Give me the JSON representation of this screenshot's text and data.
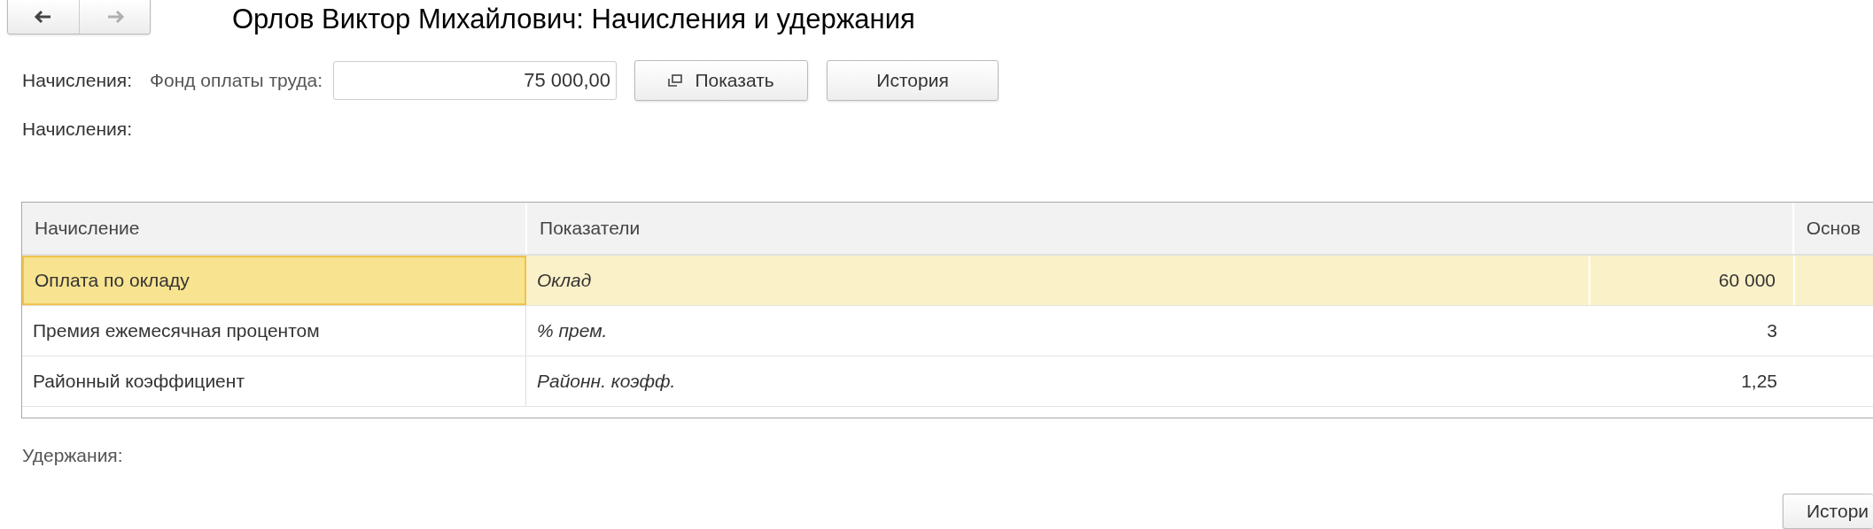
{
  "nav_buttons": [
    {
      "kind": "back",
      "disabled": false
    },
    {
      "kind": "forward",
      "disabled": true
    }
  ],
  "title": "Орлов Виктор Михайлович: Начисления и удержания",
  "accruals_label": "Начисления:",
  "fund_label": "Фонд оплаты труда:",
  "fund_value": "75 000,00",
  "show_button": "Показать",
  "history_button": "История",
  "section_label": "Начисления:",
  "table": {
    "columns": [
      "Начисление",
      "Показатели",
      "Основ"
    ],
    "rows": [
      {
        "accrual": "Оплата по окладу",
        "indicator": "Оклад",
        "value": "60 000",
        "selected": true
      },
      {
        "accrual": "Премия ежемесячная процентом",
        "indicator": "% прем.",
        "value": "3",
        "selected": false
      },
      {
        "accrual": "Районный коэффициент",
        "indicator": "Районн. коэфф.",
        "value": "1,25",
        "selected": false
      }
    ]
  },
  "deductions_label": "Удержания:",
  "bottom_button": "Истори"
}
